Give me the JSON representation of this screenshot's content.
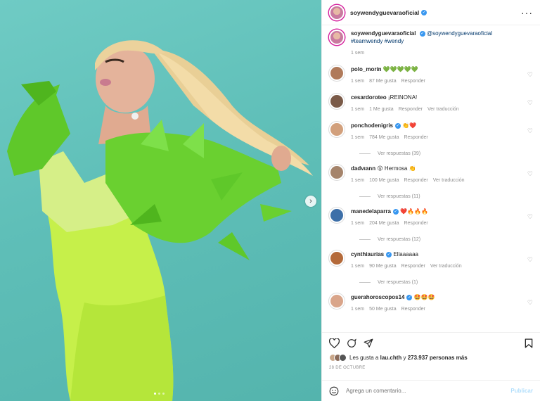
{
  "post": {
    "username": "soywendyguevaraoficial",
    "more_icon": "more-horizontal-icon",
    "carousel": {
      "current_slide": 1,
      "total_slides": 3
    }
  },
  "caption": {
    "username": "soywendyguevaraoficial",
    "mention": "@soywendyguevaraoficial",
    "hashtags": "#teamwendy #wendy",
    "time": "1 sem"
  },
  "comments": [
    {
      "username": "polo_morin",
      "verified": false,
      "text": "💚💚💚💚💚",
      "time": "1 sem",
      "likes": "87 Me gusta",
      "reply": "Responder",
      "translate": "",
      "replies": ""
    },
    {
      "username": "cesardoroteo",
      "verified": false,
      "text": "¡REINONA!",
      "time": "1 sem",
      "likes": "1 Me gusta",
      "reply": "Responder",
      "translate": "Ver traducción",
      "replies": ""
    },
    {
      "username": "ponchodenigris",
      "verified": true,
      "text": "👏❤️",
      "time": "1 sem",
      "likes": "784 Me gusta",
      "reply": "Responder",
      "translate": "",
      "replies": "Ver respuestas (39)"
    },
    {
      "username": "dadvıann",
      "verified": false,
      "text": "😮 Hermosa 👏",
      "time": "1 sem",
      "likes": "100 Me gusta",
      "reply": "Responder",
      "translate": "Ver traducción",
      "replies": "Ver respuestas (11)"
    },
    {
      "username": "manedelaparra",
      "verified": true,
      "text": "❤️🔥🔥🔥",
      "time": "1 sem",
      "likes": "204 Me gusta",
      "reply": "Responder",
      "translate": "",
      "replies": "Ver respuestas (12)"
    },
    {
      "username": "cynthiaurias",
      "verified": true,
      "text": "Ellaaaaaa",
      "time": "1 sem",
      "likes": "90 Me gusta",
      "reply": "Responder",
      "translate": "Ver traducción",
      "replies": "Ver respuestas (1)"
    },
    {
      "username": "guerahoroscopos14",
      "verified": true,
      "text": "🤩🤩🤩",
      "time": "1 sem",
      "likes": "50 Me gusta",
      "reply": "Responder",
      "translate": "",
      "replies": ""
    }
  ],
  "actions": {
    "likes_prefix": "Les gusta a ",
    "likes_user": "lau.chth",
    "likes_mid": " y ",
    "likes_count": "273.937 personas más",
    "date": "28 DE OCTUBRE"
  },
  "add_comment": {
    "placeholder": "Agrega un comentario...",
    "publish_label": "Publicar"
  },
  "colors": {
    "accent": "#3897f0",
    "background_teal": "#5fbfb8",
    "outfit_green": "#7ed321"
  }
}
